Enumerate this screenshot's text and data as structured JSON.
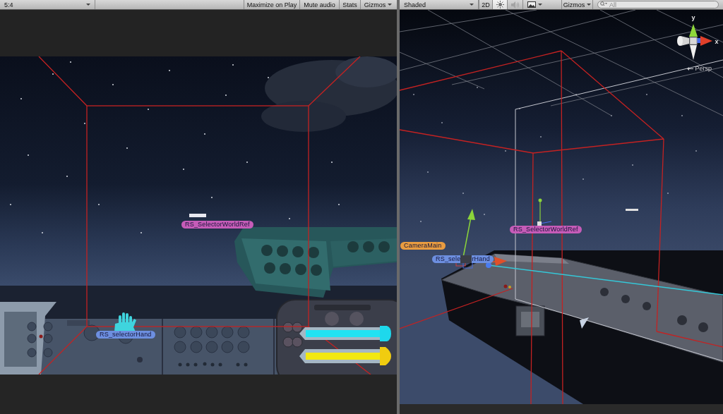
{
  "game_view": {
    "toolbar": {
      "aspect": "5:4",
      "buttons": [
        {
          "label": "Maximize on Play",
          "kind": "toggle"
        },
        {
          "label": "Mute audio",
          "kind": "toggle"
        },
        {
          "label": "Stats",
          "kind": "toggle"
        },
        {
          "label": "Gizmos",
          "kind": "dropdown"
        }
      ]
    },
    "labels": [
      {
        "parts": [
          "RS_SelectorWorldRef"
        ],
        "color": "#c65cb8"
      },
      {
        "parts": [
          "RS_selectorHand"
        ],
        "color": "#6d8fe0"
      }
    ]
  },
  "scene_view": {
    "toolbar": {
      "shading": "Shaded",
      "toggles": [
        {
          "kind": "dimension",
          "label": "2D",
          "selected": false
        },
        {
          "kind": "lighting",
          "selected": true
        },
        {
          "kind": "audio",
          "selected": false
        },
        {
          "kind": "effects",
          "selected": false
        }
      ],
      "gizmos": "Gizmos",
      "search": {
        "placeholder": "All"
      }
    },
    "orientation_gizmo": {
      "axes": [
        "y",
        "x"
      ],
      "projection": "Persp"
    },
    "labels": [
      {
        "parts": [
          "RS_SelectorWorldRef"
        ],
        "color": "#c65cb8"
      },
      {
        "parts": [
          "CameraMain"
        ],
        "color": "#e99c40"
      },
      {
        "parts": [
          "RS_sele",
          "rHand"
        ],
        "color": "#6d8fe0"
      }
    ]
  }
}
